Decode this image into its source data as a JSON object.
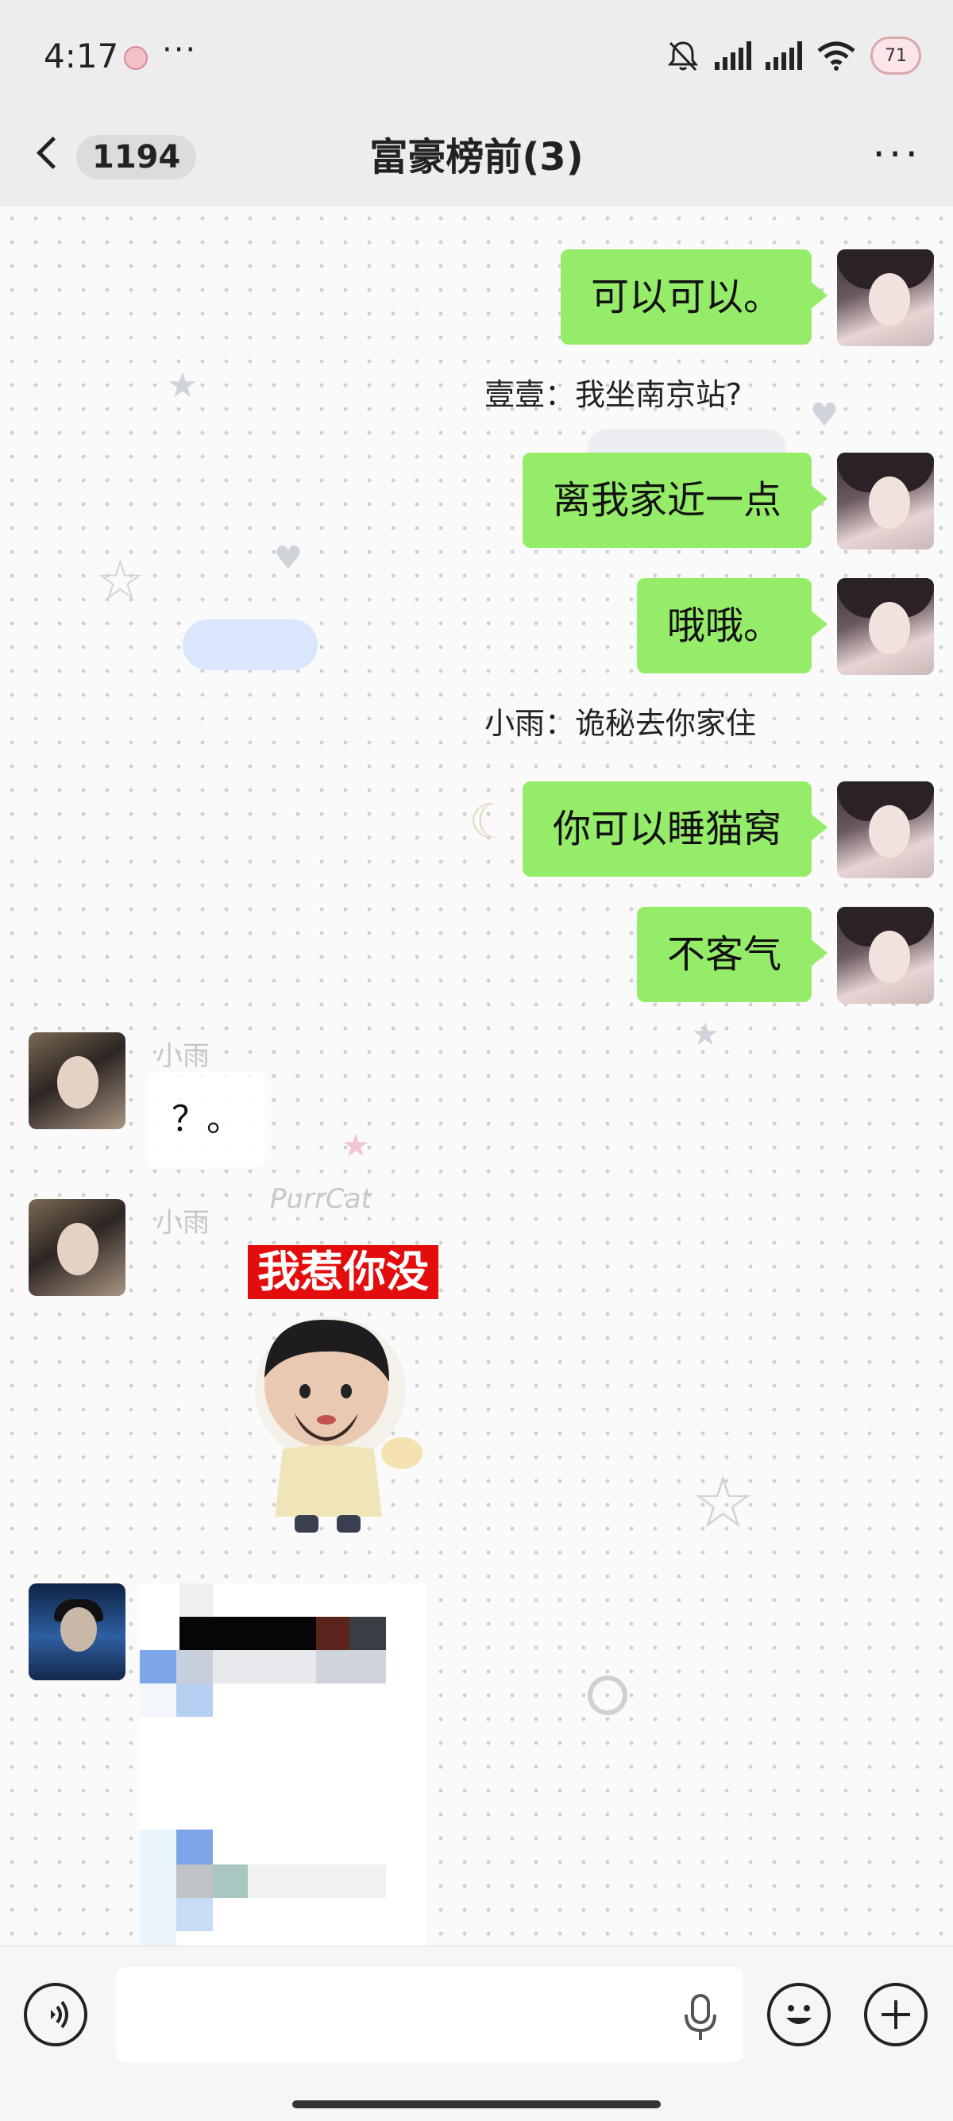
{
  "status": {
    "time": "4:17",
    "more": "···",
    "battery": "71"
  },
  "header": {
    "unread_count": "1194",
    "title": "富豪榜前(3)",
    "more": "···"
  },
  "messages": [
    {
      "type": "me",
      "text": "可以可以。"
    },
    {
      "type": "system",
      "text": "壹壹：我坐南京站?"
    },
    {
      "type": "me",
      "text": "离我家近一点"
    },
    {
      "type": "me",
      "text": "哦哦。"
    },
    {
      "type": "system",
      "text": "小雨：诡秘去你家住"
    },
    {
      "type": "me",
      "text": "你可以睡猫窝"
    },
    {
      "type": "me",
      "text": "不客气"
    },
    {
      "type": "other",
      "sender": "小雨",
      "text": "？。"
    },
    {
      "type": "other-sticker",
      "sender": "小雨",
      "caption": "我惹你没"
    },
    {
      "type": "other-image",
      "sender": ""
    }
  ],
  "deco": {
    "puffcat": "PurrCat"
  },
  "input": {
    "placeholder": ""
  },
  "icons": {
    "voice": "voice-icon",
    "emoji": "emoji-icon",
    "plus": "plus-icon",
    "mic": "mic-icon"
  }
}
